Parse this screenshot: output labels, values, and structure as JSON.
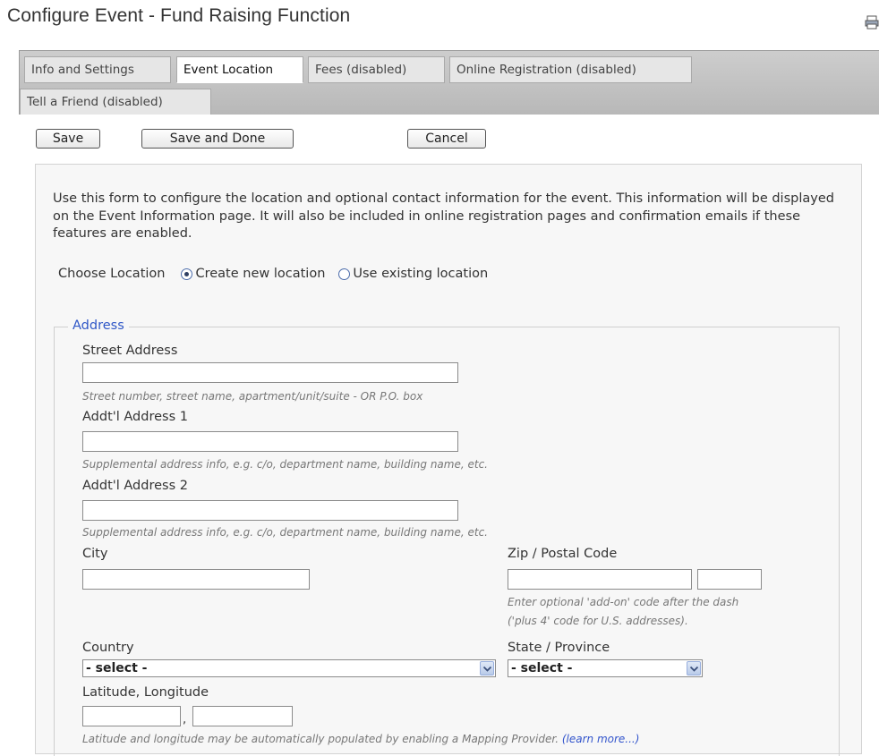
{
  "header": {
    "title": "Configure Event - Fund Raising Function"
  },
  "tabs": [
    {
      "label": "Info and Settings",
      "active": false
    },
    {
      "label": "Event Location",
      "active": true
    },
    {
      "label": "Fees (disabled)",
      "active": false
    },
    {
      "label": "Online Registration (disabled)",
      "active": false
    },
    {
      "label": "Tell a Friend (disabled)",
      "active": false
    }
  ],
  "toolbar": {
    "save_label": "Save",
    "save_done_label": "Save and Done",
    "cancel_label": "Cancel"
  },
  "form": {
    "intro": "Use this form to configure the location and optional contact information for the event. This information will be displayed on the Event Information page. It will also be included in online registration pages and confirmation emails if these features are enabled.",
    "choose_location": {
      "label": "Choose Location",
      "options": [
        {
          "label": "Create new location",
          "selected": true
        },
        {
          "label": "Use existing location",
          "selected": false
        }
      ]
    },
    "address": {
      "legend": "Address",
      "street": {
        "label": "Street Address",
        "value": "",
        "hint": "Street number, street name, apartment/unit/suite - OR P.O. box"
      },
      "addr1": {
        "label": "Addt'l Address 1",
        "value": "",
        "hint": "Supplemental address info, e.g. c/o, department name, building name, etc."
      },
      "addr2": {
        "label": "Addt'l Address 2",
        "value": "",
        "hint": "Supplemental address info, e.g. c/o, department name, building name, etc."
      },
      "city": {
        "label": "City",
        "value": ""
      },
      "zip": {
        "label": "Zip / Postal Code",
        "value": "",
        "addon_value": "",
        "hint_line1": "Enter optional 'add-on' code after the dash",
        "hint_line2": "('plus 4' code for U.S. addresses)."
      },
      "country": {
        "label": "Country",
        "selected": "- select -"
      },
      "state": {
        "label": "State / Province",
        "selected": "- select -"
      },
      "latlng": {
        "label": "Latitude, Longitude",
        "separator": ",",
        "latitude": "",
        "longitude": "",
        "hint": "Latitude and longitude may be automatically populated by enabling a Mapping Provider.",
        "link": "(learn more...)"
      }
    }
  },
  "colors": {
    "legend": "#2f57c7",
    "tab_strip": "#c4c4c4",
    "panel": "#f7f7f7",
    "hint": "#777777"
  },
  "icons": {
    "print": "printer-icon",
    "radio": "radio-icon",
    "dropdown": "chevron-down-icon"
  }
}
